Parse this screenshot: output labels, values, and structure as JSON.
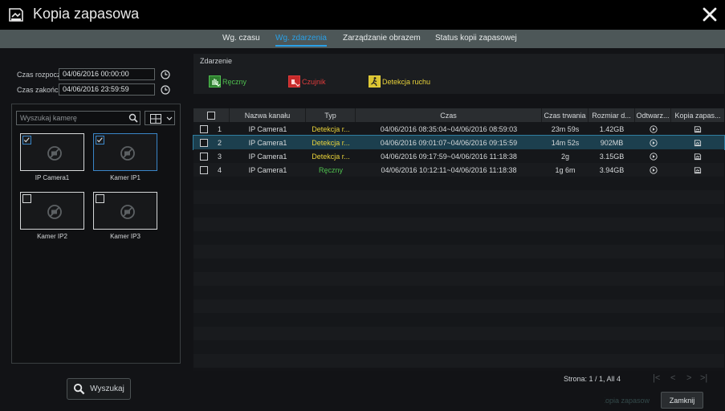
{
  "window": {
    "title": "Kopia zapasowa",
    "close_icon": "close-icon",
    "title_icon": "backup-icon"
  },
  "tabs": [
    {
      "label": "Wg. czasu",
      "active": false
    },
    {
      "label": "Wg. zdarzenia",
      "active": true
    },
    {
      "label": "Zarządzanie obrazem",
      "active": false
    },
    {
      "label": "Status kopii zapasowej",
      "active": false
    }
  ],
  "time_range": {
    "start_label": "Czas rozpoczęcia",
    "start_value": "04/06/2016 00:00:00",
    "end_label": "Czas zakończenia",
    "end_value": "04/06/2016 23:59:59"
  },
  "camera_panel": {
    "search_placeholder": "Wyszukaj kamerę",
    "cameras": [
      {
        "name": "IP Camera1",
        "checked": true,
        "selected": false
      },
      {
        "name": "Kamer IP1",
        "checked": true,
        "selected": true
      },
      {
        "name": "Kamer IP2",
        "checked": false,
        "selected": false
      },
      {
        "name": "Kamer IP3",
        "checked": false,
        "selected": false
      }
    ]
  },
  "search_button": {
    "label": "Wyszukaj"
  },
  "events": {
    "title": "Zdarzenie",
    "items": [
      {
        "label": "Ręczny",
        "color": "#4fc04f",
        "icon": "manual-hand-icon"
      },
      {
        "label": "Czujnik",
        "color": "#e03b3b",
        "icon": "sensor-icon"
      },
      {
        "label": "Detekcja ruchu",
        "color": "#e8d23a",
        "icon": "motion-detection-icon"
      }
    ]
  },
  "grid": {
    "headers": [
      "Nazwa kanału",
      "Typ",
      "Czas",
      "Czas trwania",
      "Rozmiar d...",
      "Odtwarz...",
      "Kopia zapas..."
    ],
    "rows": [
      {
        "num": "1",
        "channel": "IP Camera1",
        "type": "Detekcja r...",
        "type_color": "yellow",
        "time": "04/06/2016 08:35:04~04/06/2016 08:59:03",
        "duration": "23m 59s",
        "size": "1.42GB",
        "selected": false
      },
      {
        "num": "2",
        "channel": "IP Camera1",
        "type": "Detekcja r...",
        "type_color": "yellow",
        "time": "04/06/2016 09:01:07~04/06/2016 09:15:59",
        "duration": "14m 52s",
        "size": "902MB",
        "selected": true
      },
      {
        "num": "3",
        "channel": "IP Camera1",
        "type": "Detekcja r...",
        "type_color": "yellow",
        "time": "04/06/2016 09:17:59~04/06/2016 11:18:38",
        "duration": "2g",
        "size": "3.15GB",
        "selected": false
      },
      {
        "num": "4",
        "channel": "IP Camera1",
        "type": "Ręczny",
        "type_color": "green",
        "time": "04/06/2016 10:12:11~04/06/2016 11:18:38",
        "duration": "1g 6m",
        "size": "3.94GB",
        "selected": false
      }
    ]
  },
  "footer": {
    "pager_text": "Strona: 1 / 1, All 4",
    "backup_label": "Kopia zapasowa",
    "close_label": "Zamknij"
  }
}
